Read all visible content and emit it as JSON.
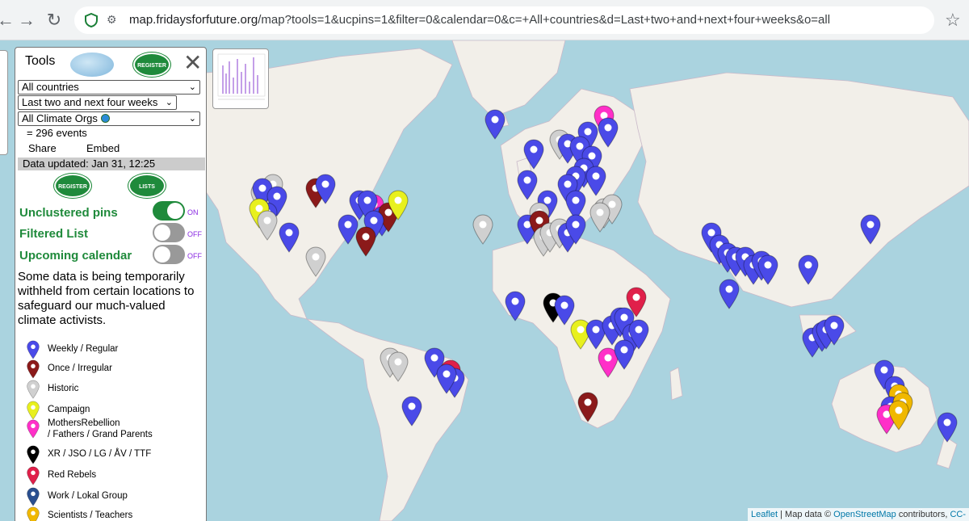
{
  "browser": {
    "url_host": "map.fridaysforfuture.org",
    "url_path": "/map?tools=1&ucpins=1&filter=0&calendar=0&c=+All+countries&d=Last+two+and+next+four+weeks&o=all"
  },
  "tools": {
    "title": "Tools",
    "register_label": "REGISTER",
    "lists_label": "LISTS",
    "country_select": "All countries",
    "date_select": "Last two and next four weeks",
    "org_select": "All Climate Orgs",
    "events_count": "= 296 events",
    "share": "Share",
    "embed": "Embed",
    "data_updated": "Data updated: Jan 31, 12:25",
    "toggles": [
      {
        "label": "Unclustered pins",
        "state": "ON"
      },
      {
        "label": "Filtered List",
        "state": "OFF"
      },
      {
        "label": "Upcoming calendar",
        "state": "OFF"
      }
    ],
    "note": "Some data is being temporarily withheld from certain locations to safeguard our much-valued climate activists."
  },
  "legend": [
    {
      "label": "Weekly / Regular",
      "color": "#4a4ae8",
      "icon": "map-pin-icon"
    },
    {
      "label": "Once / Irregular",
      "color": "#8b1a1a",
      "icon": "map-pin-icon"
    },
    {
      "label": "Historic",
      "color": "#d0d0d0",
      "icon": "map-pin-icon"
    },
    {
      "label": "Campaign",
      "color": "#e8f01e",
      "icon": "map-pin-icon"
    },
    {
      "label": "MothersRebellion",
      "label2": "/ Fathers / Grand Parents",
      "color": "#ff2fc8",
      "icon": "map-pin-icon"
    },
    {
      "label": "XR / JSO / LG / ÅV / TTF",
      "color": "#000000",
      "icon": "map-pin-icon"
    },
    {
      "label": "Red Rebels",
      "color": "#e0204a",
      "icon": "map-pin-icon"
    },
    {
      "label": "Work / Lokal Group",
      "color": "#2a4f8f",
      "icon": "map-pin-icon"
    },
    {
      "label": "Scientists / Teachers",
      "color": "#f0b800",
      "icon": "map-pin-icon"
    }
  ],
  "attribution": {
    "leaflet": "Leaflet",
    "sep": " | Map data © ",
    "osm": "OpenStreetMap",
    "contrib": " contributors, ",
    "cc": "CC-"
  }
}
